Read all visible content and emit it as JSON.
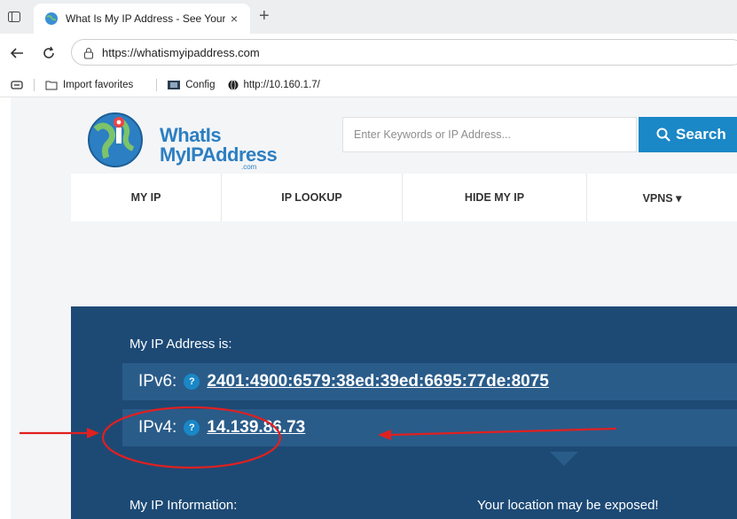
{
  "browser": {
    "tab_title": "What Is My IP Address - See Your",
    "tab_close_glyph": "×",
    "new_tab_glyph": "+",
    "url": "https://whatismyipaddress.com",
    "favorites": [
      {
        "label": "Import favorites",
        "icon": "import-favorites-icon"
      },
      {
        "label": "Config",
        "icon": "config-icon"
      },
      {
        "label": "http://10.160.1.7/",
        "icon": "globe-icon"
      }
    ]
  },
  "site": {
    "logo": {
      "line1": "WhatIs",
      "line2": "MyIPAddress",
      "suffix": ".com"
    },
    "search": {
      "placeholder": "Enter Keywords or IP Address...",
      "button_label": "Search"
    },
    "nav": [
      {
        "label": "MY IP"
      },
      {
        "label": "IP LOOKUP"
      },
      {
        "label": "HIDE MY IP"
      },
      {
        "label": "VPNS ▾"
      }
    ],
    "hero": {
      "heading": "My IP Address is:",
      "ipv6_label": "IPv6:",
      "ipv6_value": "2401:4900:6579:38ed:39ed:6695:77de:8075",
      "ipv4_label": "IPv4:",
      "ipv4_value": "14.139.86.73",
      "help_glyph": "?",
      "info_heading": "My IP Information:",
      "warning": "Your location may be exposed!"
    }
  },
  "colors": {
    "hero_bg": "#1d4a75",
    "row_bg": "#2a5c8a",
    "accent": "#1a87c7",
    "annotation": "#e02020"
  }
}
